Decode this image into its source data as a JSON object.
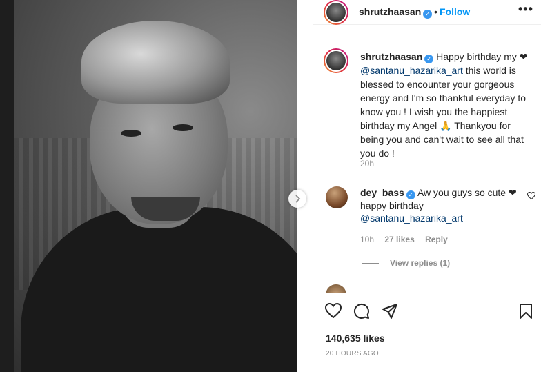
{
  "post": {
    "username": "shrutzhaasan",
    "dot": "•",
    "follow_label": "Follow",
    "more_label": "•••"
  },
  "caption": {
    "username": "shrutzhaasan",
    "text_before": " Happy birthday my ❤ ",
    "mention": "@santanu_hazarika_art",
    "text_after": " this world is blessed to encounter your gorgeous energy and I'm so thankful everyday to know you ! I wish you the happiest birthday my Angel 🙏 Thankyou for being you and can't wait to see all that you do !",
    "time": "20h"
  },
  "comment": {
    "username": "dey_bass",
    "text": " Aw you guys so cute ❤ happy birthday ",
    "mention": "@santanu_hazarika_art",
    "time": "10h",
    "likes": "27 likes",
    "reply_label": "Reply",
    "view_replies": "View replies (1)"
  },
  "footer": {
    "likes": "140,635 likes",
    "ago": "20 HOURS AGO"
  },
  "icons": {
    "verified": "verified-badge-icon",
    "heart": "heart-icon",
    "comment": "comment-icon",
    "share": "share-icon",
    "save": "bookmark-icon",
    "next": "chevron-right-icon"
  },
  "colors": {
    "link": "#0095f6",
    "mention": "#00376b",
    "verified": "#3897f0",
    "meta": "#8e8e8e"
  }
}
